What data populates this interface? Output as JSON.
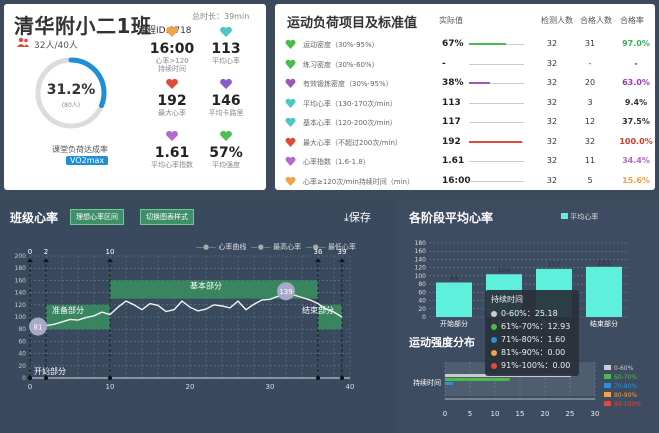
{
  "class_panel": {
    "class_name": "清华附小二1班",
    "duration": "总时长：39min",
    "course_id": "课程ID:8718",
    "counts": "32人/40人",
    "ring_percent": "31.2%",
    "ring_sub": "(80人)",
    "ring_value": 0.312,
    "caption": "课堂负荷达成率",
    "badge": "VO2max",
    "stats": [
      {
        "value": "16:00",
        "label": "心率>120\n持续时间",
        "icon": "heart-clock-icon",
        "color": "#f2a24a"
      },
      {
        "value": "113",
        "label": "平均心率",
        "icon": "heart-pulse-icon",
        "color": "#4cc8c0"
      },
      {
        "value": "192",
        "label": "最大心率",
        "icon": "heart-max-icon",
        "color": "#e04a3a"
      },
      {
        "value": "146",
        "label": "平均卡路里",
        "icon": "lightning-icon",
        "color": "#8a5cc8"
      },
      {
        "value": "1.61",
        "label": "平均心率指数",
        "icon": "heart-index-icon",
        "color": "#b06ad0"
      },
      {
        "value": "57%",
        "label": "平均强度",
        "icon": "runner-icon",
        "color": "#4cc050"
      }
    ]
  },
  "metrics_panel": {
    "title": "运动负荷项目及标准值",
    "headers": [
      "实际值",
      "检测人数",
      "合格人数",
      "合格率"
    ],
    "rows": [
      {
        "name": "运动密度（30%-95%）",
        "actual": "67%",
        "fill": 0.67,
        "fill_color": "#4cbb4c",
        "tested": "32",
        "qualified": "31",
        "rate": "97.0%",
        "rate_color": "#3cae5a",
        "icon_color": "#4cbb4c"
      },
      {
        "name": "练习密度（30%-60%）",
        "actual": "-",
        "fill": 0,
        "fill_color": "#4cbb4c",
        "tested": "32",
        "qualified": "-",
        "rate": "-",
        "rate_color": "#333",
        "icon_color": "#4cbb4c"
      },
      {
        "name": "有效锻炼密度（30%-95%）",
        "actual": "38%",
        "fill": 0.38,
        "fill_color": "#9b59b6",
        "tested": "32",
        "qualified": "20",
        "rate": "63.0%",
        "rate_color": "#9b3bb0",
        "icon_color": "#9b59b6"
      },
      {
        "name": "平均心率（130-170次/min）",
        "actual": "113",
        "fill": 0,
        "fill_color": "#4cc8c0",
        "tested": "32",
        "qualified": "3",
        "rate": "9.4%",
        "rate_color": "#333",
        "icon_color": "#4cc8c0"
      },
      {
        "name": "基本心率（120-200次/min）",
        "actual": "117",
        "fill": 0,
        "fill_color": "#4cc8c0",
        "tested": "32",
        "qualified": "12",
        "rate": "37.5%",
        "rate_color": "#333",
        "icon_color": "#4cc8c0"
      },
      {
        "name": "最大心率（不超过200次/min）",
        "actual": "192",
        "fill": 0.96,
        "fill_color": "#e04a3a",
        "tested": "32",
        "qualified": "32",
        "rate": "100.0%",
        "rate_color": "#d43a2a",
        "icon_color": "#e04a3a"
      },
      {
        "name": "心率指数（1.6-1.8）",
        "actual": "1.61",
        "fill": 0,
        "fill_color": "#b06ad0",
        "tested": "32",
        "qualified": "11",
        "rate": "34.4%",
        "rate_color": "#b06ad0",
        "icon_color": "#b06ad0"
      },
      {
        "name": "心率≥120次/min持续时间（min）",
        "actual": "16:00",
        "fill": 0,
        "fill_color": "#f2a24a",
        "tested": "32",
        "qualified": "5",
        "rate": "15.6%",
        "rate_color": "#f2a24a",
        "icon_color": "#f2a24a"
      }
    ]
  },
  "hr_panel": {
    "title": "班级心率",
    "btn_ideal": "理想心率区间",
    "btn_switch": "切换图表样式",
    "save": "保存",
    "legend": [
      "心率曲线",
      "最高心率",
      "最低心率"
    ],
    "phase_labels": [
      "准备部分",
      "基本部分",
      "结束部分",
      "开始部分"
    ],
    "marker_labels": [
      "0",
      "2",
      "10",
      "36",
      "39"
    ],
    "point_labels": [
      "81",
      "139"
    ]
  },
  "avg_panel": {
    "title": "各阶段平均心率",
    "legend": "平均心率",
    "sub_title": "运动强度分布",
    "bar_categories": [
      "开始部分",
      "准备部分",
      "基本部分",
      "结束部分"
    ],
    "y_ticks": [
      "180",
      "160",
      "140",
      "120",
      "100",
      "80",
      "60",
      "40",
      "20",
      "0"
    ],
    "dist_x_ticks": [
      "0",
      "5",
      "10",
      "15",
      "20",
      "25",
      "30"
    ],
    "dist_label": "持续时间",
    "dist_legend": [
      "0-60%",
      "60-70%",
      "70-80%",
      "80-90%",
      "90-100%"
    ],
    "tooltip_title": "持续时间",
    "tooltip_rows": [
      {
        "text": "0-60%：25.18",
        "color": "#cccccc"
      },
      {
        "text": "61%-70%：12.93",
        "color": "#4cbb4c"
      },
      {
        "text": "71%-80%：1.60",
        "color": "#2e8fd8"
      },
      {
        "text": "81%-90%：0.00",
        "color": "#f2a24a"
      },
      {
        "text": "91%-100%：0.00",
        "color": "#e04a3a"
      }
    ]
  },
  "chart_data": [
    {
      "type": "line",
      "title": "班级心率",
      "xlim": [
        0,
        40
      ],
      "ylim": [
        0,
        200
      ],
      "x_ticks": [
        0,
        10,
        20,
        30,
        40
      ],
      "y_ticks": [
        0,
        20,
        40,
        60,
        80,
        100,
        120,
        140,
        160,
        180,
        200
      ],
      "series": [
        {
          "name": "心率曲线",
          "x": [
            0,
            1,
            2,
            3,
            4,
            5,
            6,
            7,
            8,
            9,
            10,
            11,
            12,
            13,
            14,
            15,
            16,
            17,
            18,
            19,
            20,
            21,
            22,
            23,
            24,
            25,
            26,
            27,
            28,
            29,
            30,
            31,
            32,
            33,
            34,
            35,
            36,
            37,
            38,
            39
          ],
          "values": [
            78,
            81,
            86,
            88,
            92,
            96,
            95,
            99,
            102,
            108,
            104,
            116,
            126,
            120,
            112,
            122,
            119,
            109,
            112,
            126,
            116,
            110,
            113,
            120,
            118,
            115,
            126,
            112,
            121,
            128,
            129,
            134,
            139,
            136,
            132,
            128,
            122,
            113,
            108,
            100
          ]
        }
      ],
      "phases": [
        {
          "name": "准备部分",
          "x": [
            2,
            10
          ],
          "y": [
            80,
            120
          ]
        },
        {
          "name": "基本部分",
          "x": [
            10,
            36
          ],
          "y": [
            130,
            160
          ]
        },
        {
          "name": "结束部分",
          "x": [
            36,
            39
          ],
          "y": [
            80,
            120
          ]
        }
      ]
    },
    {
      "type": "bar",
      "title": "各阶段平均心率",
      "categories": [
        "开始部分",
        "准备部分",
        "基本部分",
        "结束部分"
      ],
      "series": [
        {
          "name": "平均心率",
          "values": [
            84,
            104,
            117,
            122
          ]
        }
      ],
      "ylim": [
        0,
        180
      ]
    },
    {
      "type": "bar",
      "title": "运动强度分布",
      "categories": [
        "持续时间"
      ],
      "series": [
        {
          "name": "0-60%",
          "values": [
            25.18
          ]
        },
        {
          "name": "60-70%",
          "values": [
            12.93
          ]
        },
        {
          "name": "70-80%",
          "values": [
            1.6
          ]
        },
        {
          "name": "80-90%",
          "values": [
            0
          ]
        },
        {
          "name": "90-100%",
          "values": [
            0
          ]
        }
      ],
      "xlim": [
        0,
        30
      ]
    }
  ]
}
